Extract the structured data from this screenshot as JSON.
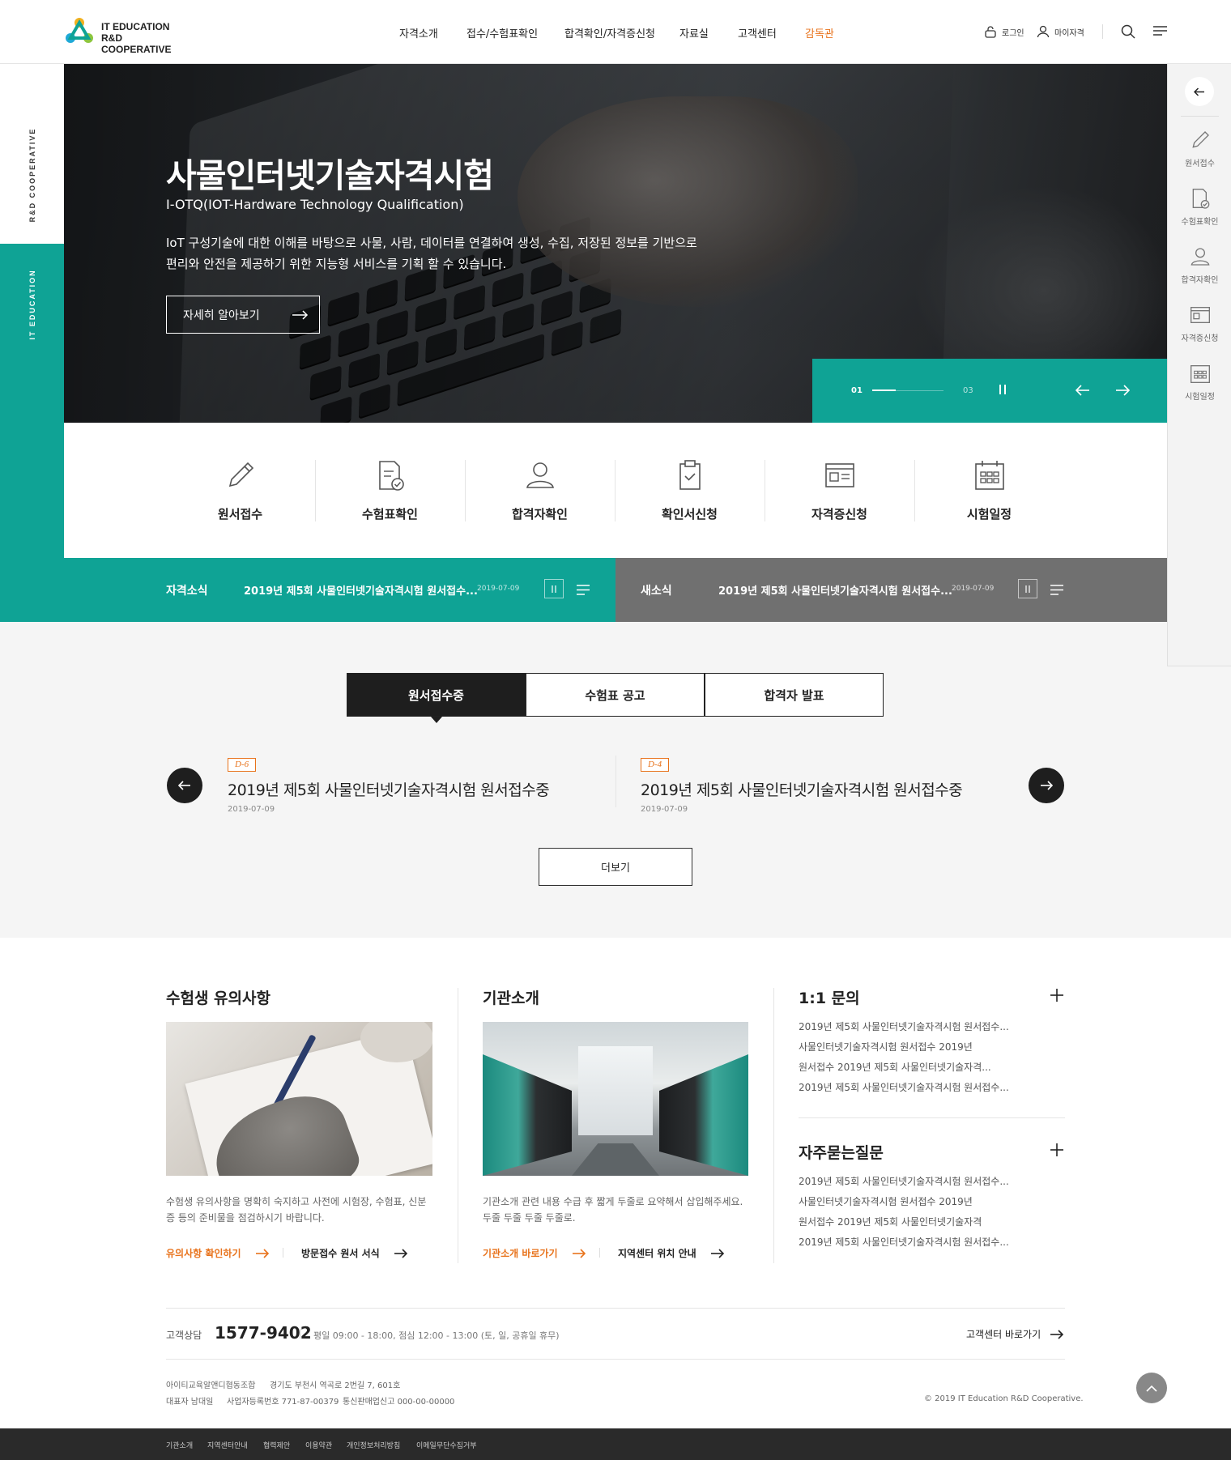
{
  "header": {
    "logo_line1": "IT EDUCATION",
    "logo_line2": "R&D COOPERATIVE",
    "nav": [
      "자격소개",
      "접수/수험표확인",
      "합격확인/자격증신청",
      "자료실",
      "고객센터",
      "감독관"
    ],
    "login_label": "로그인",
    "mypage_label": "마이자격"
  },
  "side": {
    "top_label": "R&D COOPERATIVE",
    "bottom_label": "IT EDUCATION"
  },
  "hero": {
    "title": "사물인터넷기술자격시험",
    "subtitle": "I-OTQ(IOT-Hardware Technology Qualification)",
    "desc_line1": "IoT 구성기술에 대한 이해를 바탕으로 사물, 사람, 데이터를 연결하여 생성, 수집, 저장된 정보를 기반으로",
    "desc_line2": "편리와 안전을 제공하기 위한 지능형 서비스를 기획 할 수 있습니다.",
    "button_label": "자세히 알아보기",
    "slide_current": "01",
    "slide_total": "03",
    "slide_progress": 0.33
  },
  "quick_menu": [
    "원서접수",
    "수험표확인",
    "합격자확인",
    "확인서신청",
    "자격증신청",
    "시험일정"
  ],
  "news": {
    "left_label": "자격소식",
    "left_text": "2019년 제5회 사물인터넷기술자격시험 원서접수...",
    "left_date": "2019-07-09",
    "right_label": "새소식",
    "right_text": "2019년 제5회 사물인터넷기술자격시험 원서접수...",
    "right_date": "2019-07-09"
  },
  "right_bar": [
    "원서접수",
    "수험표확인",
    "합격자확인",
    "자격증신청",
    "시험일정"
  ],
  "tabs": [
    "원서접수중",
    "수험표 공고",
    "합격자 발표"
  ],
  "notices": [
    {
      "badge": "D-6",
      "title": "2019년 제5회 사물인터넷기술자격시험 원서접수중",
      "date": "2019-07-09"
    },
    {
      "badge": "D-4",
      "title": "2019년 제5회 사물인터넷기술자격시험 원서접수중",
      "date": "2019-07-09"
    }
  ],
  "more_label": "더보기",
  "col1": {
    "title": "수험생 유의사항",
    "desc": "수험생 유의사항을 명확히 숙지하고 사전에 시험장, 수험표, 신분증 등의 준비물을 점검하시기 바랍니다.",
    "link1": "유의사항 확인하기",
    "link2": "방문접수 원서 서식"
  },
  "col2": {
    "title": "기관소개",
    "desc": "기관소개 관련 내용 수급 후 짧게 두줄로 요약해서 삽입해주세요. 두줄 두줄 두줄 두줄로.",
    "link1": "기관소개 바로가기",
    "link2": "지역센터 위치 안내"
  },
  "col3": {
    "title1": "1:1 문의",
    "list1": [
      "2019년 제5회 사물인터넷기술자격시험 원서접수...",
      "사물인터넷기술자격시험 원서접수 2019년",
      "원서접수 2019년 제5회 사물인터넷기술자격...",
      "2019년 제5회 사물인터넷기술자격시험 원서접수..."
    ],
    "title2": "자주묻는질문",
    "list2": [
      "2019년 제5회 사물인터넷기술자격시험 원서접수...",
      "사물인터넷기술자격시험 원서접수 2019년",
      "원서접수 2019년 제5회 사물인터넷기술자격",
      "2019년 제5회 사물인터넷기술자격시험 원서접수..."
    ]
  },
  "footer": {
    "cs_label": "고객상담",
    "cs_phone": "1577-9402",
    "cs_hours": "평일 09:00 - 18:00, 점심 12:00 - 13:00 (토, 일, 공휴일 휴무)",
    "cs_link": "고객센터 바로가기",
    "company": "아이티교육알앤디협동조합",
    "address": "경기도 부천시 역곡로 2번길 7, 601호",
    "ceo": "대표자 남대일",
    "biz_no": "사업자등록번호 771-87-00379",
    "mail_order": "통신판매업신고 000-00-00000",
    "copyright": "© 2019 IT Education R&D Cooperative.",
    "links": [
      "기관소개",
      "지역센터안내",
      "협력제안",
      "이용약관",
      "개인정보처리방침",
      "이메일무단수집거부"
    ]
  },
  "colors": {
    "accent": "#0fa395",
    "orange": "#e8731c",
    "dark": "#1e1e1e",
    "gray_bar": "#707070"
  }
}
